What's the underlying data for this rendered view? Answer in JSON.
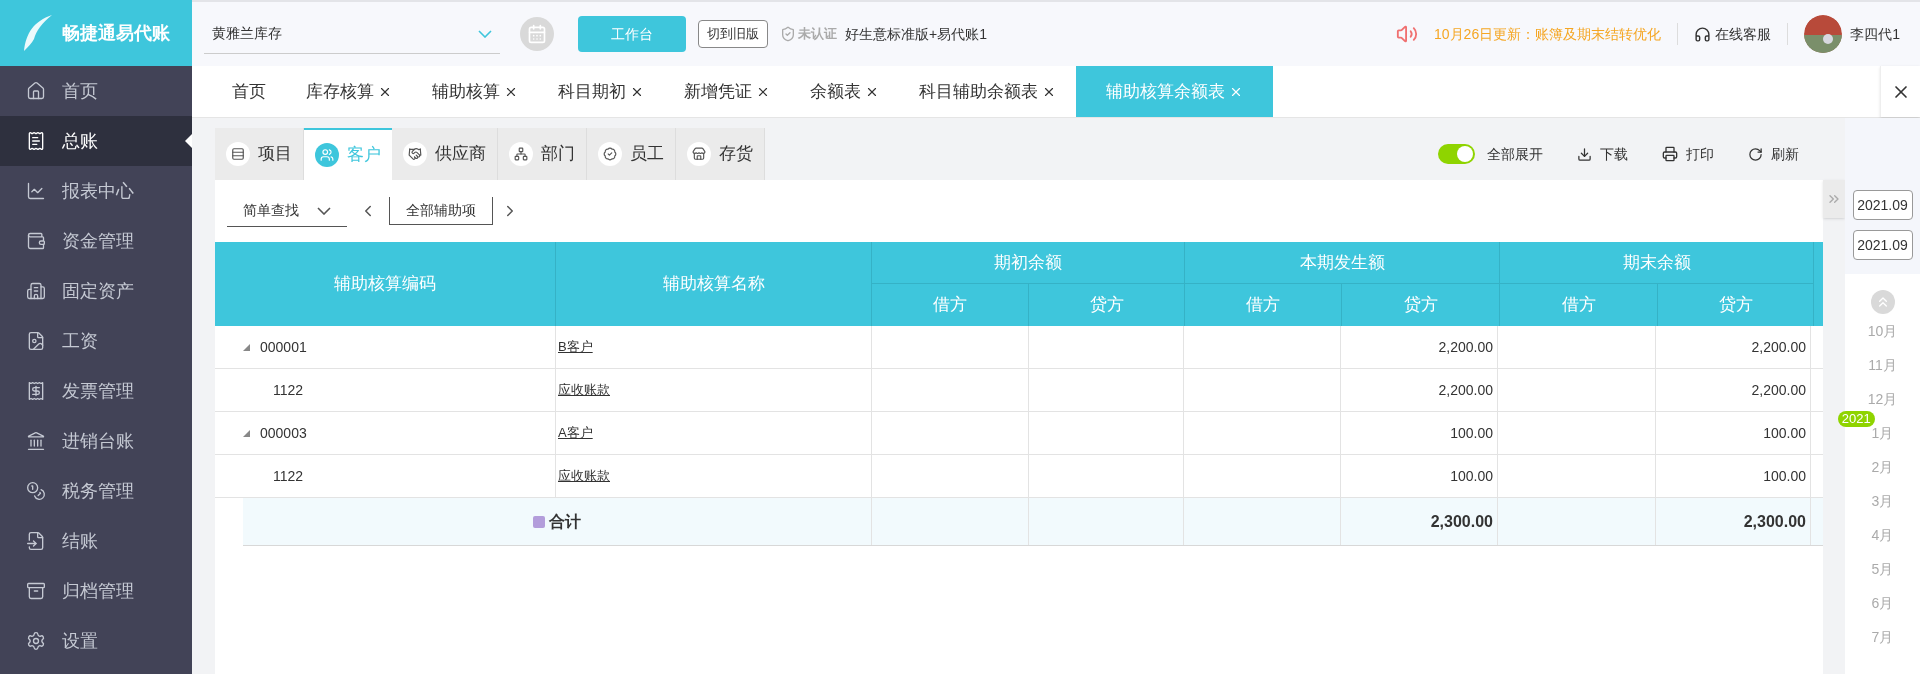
{
  "top_bar": {
    "logo_text": "畅捷通易代账",
    "company": "黄雅兰库存",
    "workbench_button": "工作台",
    "old_version_button": "切到旧版",
    "cert_status": "未认证",
    "product": "好生意标准版+易代账1",
    "notice": "10月26日更新：账簿及期末结转优化",
    "support": "在线客服",
    "user": "李四代1"
  },
  "sidebar": {
    "items": [
      {
        "label": "首页",
        "selected": false
      },
      {
        "label": "总账",
        "selected": true
      },
      {
        "label": "报表中心",
        "selected": false
      },
      {
        "label": "资金管理",
        "selected": false
      },
      {
        "label": "固定资产",
        "selected": false
      },
      {
        "label": "工资",
        "selected": false
      },
      {
        "label": "发票管理",
        "selected": false
      },
      {
        "label": "进销台账",
        "selected": false
      },
      {
        "label": "税务管理",
        "selected": false
      },
      {
        "label": "结账",
        "selected": false
      },
      {
        "label": "归档管理",
        "selected": false
      },
      {
        "label": "设置",
        "selected": false
      }
    ]
  },
  "tabs": [
    {
      "label": "首页",
      "selected": false,
      "closable": false
    },
    {
      "label": "库存核算",
      "selected": false,
      "closable": true
    },
    {
      "label": "辅助核算",
      "selected": false,
      "closable": true
    },
    {
      "label": "科目期初",
      "selected": false,
      "closable": true
    },
    {
      "label": "新增凭证",
      "selected": false,
      "closable": true
    },
    {
      "label": "余额表",
      "selected": false,
      "closable": true
    },
    {
      "label": "科目辅助余额表",
      "selected": false,
      "closable": true
    },
    {
      "label": "辅助核算余额表",
      "selected": true,
      "closable": true
    }
  ],
  "sub_tabs": [
    {
      "label": "项目",
      "selected": false
    },
    {
      "label": "客户",
      "selected": true
    },
    {
      "label": "供应商",
      "selected": false
    },
    {
      "label": "部门",
      "selected": false
    },
    {
      "label": "员工",
      "selected": false
    },
    {
      "label": "存货",
      "selected": false
    }
  ],
  "toolbar": {
    "expand_all": {
      "label": "全部展开",
      "on": true
    },
    "download": "下载",
    "print": "打印",
    "refresh": "刷新"
  },
  "filter": {
    "search_mode": "简单查找",
    "aux_item": "全部辅助项"
  },
  "table": {
    "code_header": "辅助核算编码",
    "name_header": "辅助核算名称",
    "groups": [
      {
        "label": "期初余额",
        "columns": [
          "借方",
          "贷方"
        ]
      },
      {
        "label": "本期发生额",
        "columns": [
          "借方",
          "贷方"
        ]
      },
      {
        "label": "期末余额",
        "columns": [
          "借方",
          "贷方"
        ]
      }
    ],
    "rows": [
      {
        "kind": "group",
        "expanded": true,
        "code": "000001",
        "name": "B客户",
        "values": {
          "current_credit": "2,200.00",
          "end_credit": "2,200.00"
        }
      },
      {
        "kind": "account",
        "code": "1122",
        "name": "应收账款",
        "values": {
          "current_credit": "2,200.00",
          "end_credit": "2,200.00"
        }
      },
      {
        "kind": "group",
        "expanded": true,
        "code": "000003",
        "name": "A客户",
        "values": {
          "current_credit": "100.00",
          "end_credit": "100.00"
        }
      },
      {
        "kind": "account",
        "code": "1122",
        "name": "应收账款",
        "values": {
          "current_credit": "100.00",
          "end_credit": "100.00"
        }
      }
    ],
    "total": {
      "label": "合计",
      "values": {
        "current_credit": "2,300.00",
        "end_credit": "2,300.00"
      }
    }
  },
  "period_panel": {
    "start": "2021.09",
    "end": "2021.09",
    "year_badge": "2021",
    "months": [
      "10月",
      "11月",
      "12月",
      "1月",
      "2月",
      "3月",
      "4月",
      "5月",
      "6月",
      "7月"
    ]
  }
}
